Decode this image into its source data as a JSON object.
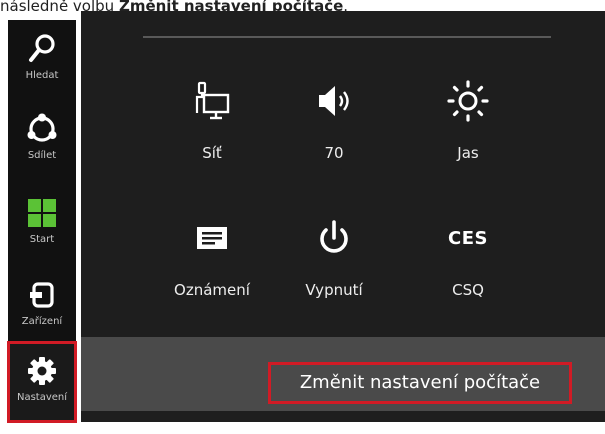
{
  "caption": {
    "prefix": "následně volbu ",
    "bold": "Změnit nastavení počítače",
    "suffix": "."
  },
  "charms": [
    {
      "label": "Hledat",
      "icon": "search-icon"
    },
    {
      "label": "Sdílet",
      "icon": "share-icon"
    },
    {
      "label": "Start",
      "icon": "windows-logo-icon"
    },
    {
      "label": "Zařízení",
      "icon": "devices-icon"
    },
    {
      "label": "Nastavení",
      "icon": "gear-icon"
    }
  ],
  "settings": {
    "tiles": [
      {
        "label": "Síť",
        "icon": "network-icon"
      },
      {
        "label": "70",
        "icon": "volume-icon"
      },
      {
        "label": "Jas",
        "icon": "brightness-icon"
      },
      {
        "label": "Oznámení",
        "icon": "notifications-icon"
      },
      {
        "label": "Vypnutí",
        "icon": "power-icon"
      },
      {
        "label": "CSQ",
        "icon": "keyboard-language-icon",
        "icon_text": "CES"
      }
    ],
    "change_pc_settings": "Změnit nastavení počítače"
  },
  "colors": {
    "charms_bg": "#111111",
    "flyout_bg": "#1e1e1e",
    "bottom_bar": "#4a4a4a",
    "highlight": "#d11b25",
    "windows_green": "#5bc236"
  }
}
